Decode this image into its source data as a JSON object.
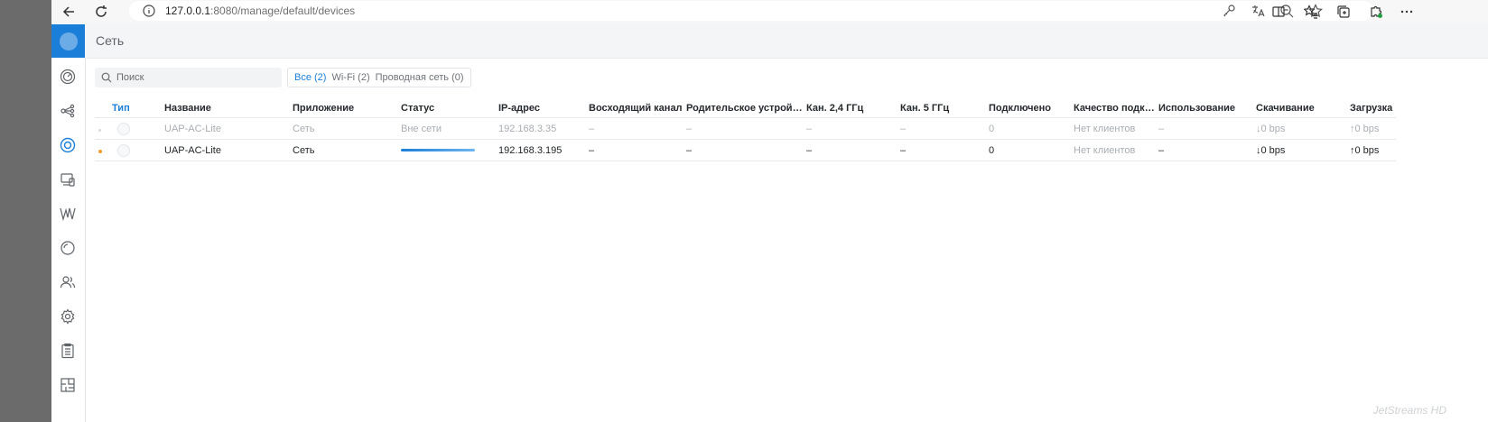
{
  "browser": {
    "url_host": "127.0.0.1",
    "url_path": ":8080/manage/default/devices",
    "icons": [
      "back-icon",
      "reload-icon",
      "info-icon",
      "key-icon",
      "translate-icon",
      "zoom-out-icon",
      "favorite-icon",
      "split-screen-icon",
      "favorites-icon",
      "collections-icon",
      "extensions-icon",
      "more-icon"
    ]
  },
  "sidebar": {
    "items": [
      {
        "name": "dashboard",
        "icon": "dashboard-icon"
      },
      {
        "name": "topology",
        "icon": "topology-icon"
      },
      {
        "name": "devices",
        "icon": "devices-icon",
        "active": true
      },
      {
        "name": "clients",
        "icon": "clients-icon"
      },
      {
        "name": "statistics",
        "icon": "statistics-icon"
      },
      {
        "name": "insights",
        "icon": "insights-icon"
      },
      {
        "name": "hotspot",
        "icon": "hotspot-icon"
      },
      {
        "name": "settings",
        "icon": "gear-icon"
      },
      {
        "name": "events",
        "icon": "clipboard-icon"
      },
      {
        "name": "floorplan",
        "icon": "floorplan-icon"
      }
    ]
  },
  "header": {
    "title": "Сеть"
  },
  "search": {
    "placeholder": "Поиск"
  },
  "filters": [
    {
      "label": "Все (2)",
      "active": true
    },
    {
      "label": "Wi-Fi (2)",
      "active": false
    },
    {
      "label": "Проводная сеть (0)",
      "active": false
    }
  ],
  "table": {
    "columns": [
      "Тип",
      "Название",
      "Приложение",
      "Статус",
      "IP-адрес",
      "Восходящий канал",
      "Родительское устройство",
      "Кан. 2,4 ГГц",
      "Кан. 5 ГГц",
      "Подключено",
      "Качество подключения",
      "Использование",
      "Скачивание",
      "Загрузка"
    ],
    "rows": [
      {
        "state": "offline",
        "name": "UAP-AC-Lite",
        "app": "Сеть",
        "status": "Вне сети",
        "status_progress": null,
        "ip": "192.168.3.35",
        "uplink": "–",
        "parent": "–",
        "ch24": "–",
        "ch5": "–",
        "connected": "0",
        "quality": "Нет клиентов",
        "usage": "–",
        "download": "0 bps",
        "upload": "0 bps"
      },
      {
        "state": "online",
        "name": "UAP-AC-Lite",
        "app": "Сеть",
        "status": "",
        "status_progress": 1.0,
        "ip": "192.168.3.195",
        "uplink": "–",
        "parent": "–",
        "ch24": "–",
        "ch5": "–",
        "connected": "0",
        "quality": "Нет клиентов",
        "usage": "–",
        "download": "0 bps",
        "upload": "0 bps"
      }
    ]
  },
  "watermark": "JetStreams HD",
  "colors": {
    "accent": "#1b7fd9",
    "status_dot_online": "#f29d2b",
    "muted": "#a8adb3"
  }
}
